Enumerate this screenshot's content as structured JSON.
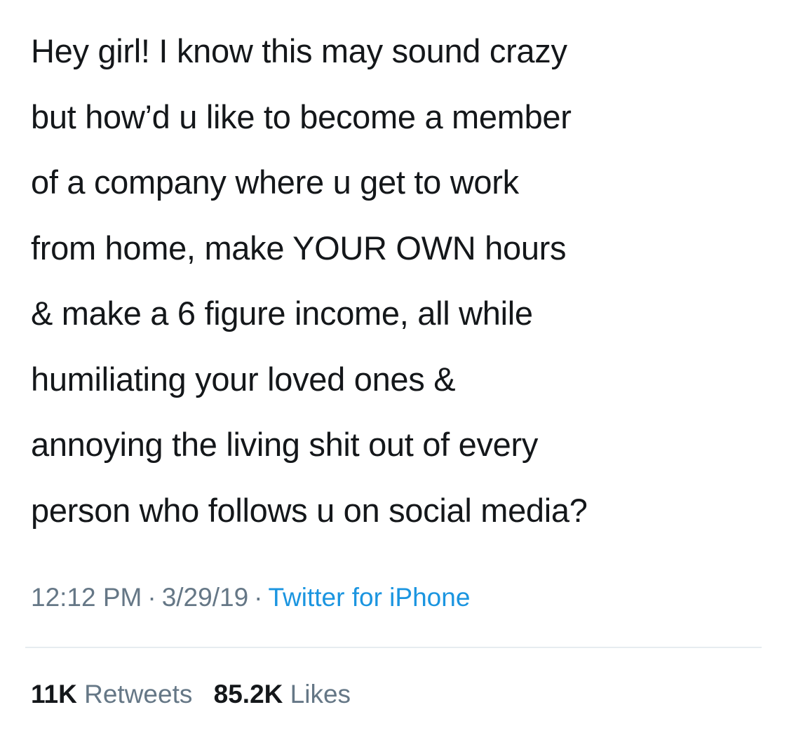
{
  "tweet": {
    "lines": [
      "Hey girl! I know this may sound crazy",
      "but how’d u like to become a member",
      "of a company where u get to work",
      "from home, make YOUR OWN hours",
      "& make a 6 figure income, all while",
      "humiliating your loved ones &",
      "annoying the living shit out of every",
      "person who follows u on social media?"
    ],
    "time": "12:12 PM",
    "separator": "·",
    "date": "3/29/19",
    "source": "Twitter for iPhone"
  },
  "stats": {
    "retweets_count": "11K",
    "retweets_label": "Retweets",
    "likes_count": "85.2K",
    "likes_label": "Likes"
  },
  "colors": {
    "text": "#14171a",
    "secondary": "#657786",
    "link": "#1b95e0",
    "divider": "#e6ecf0"
  }
}
